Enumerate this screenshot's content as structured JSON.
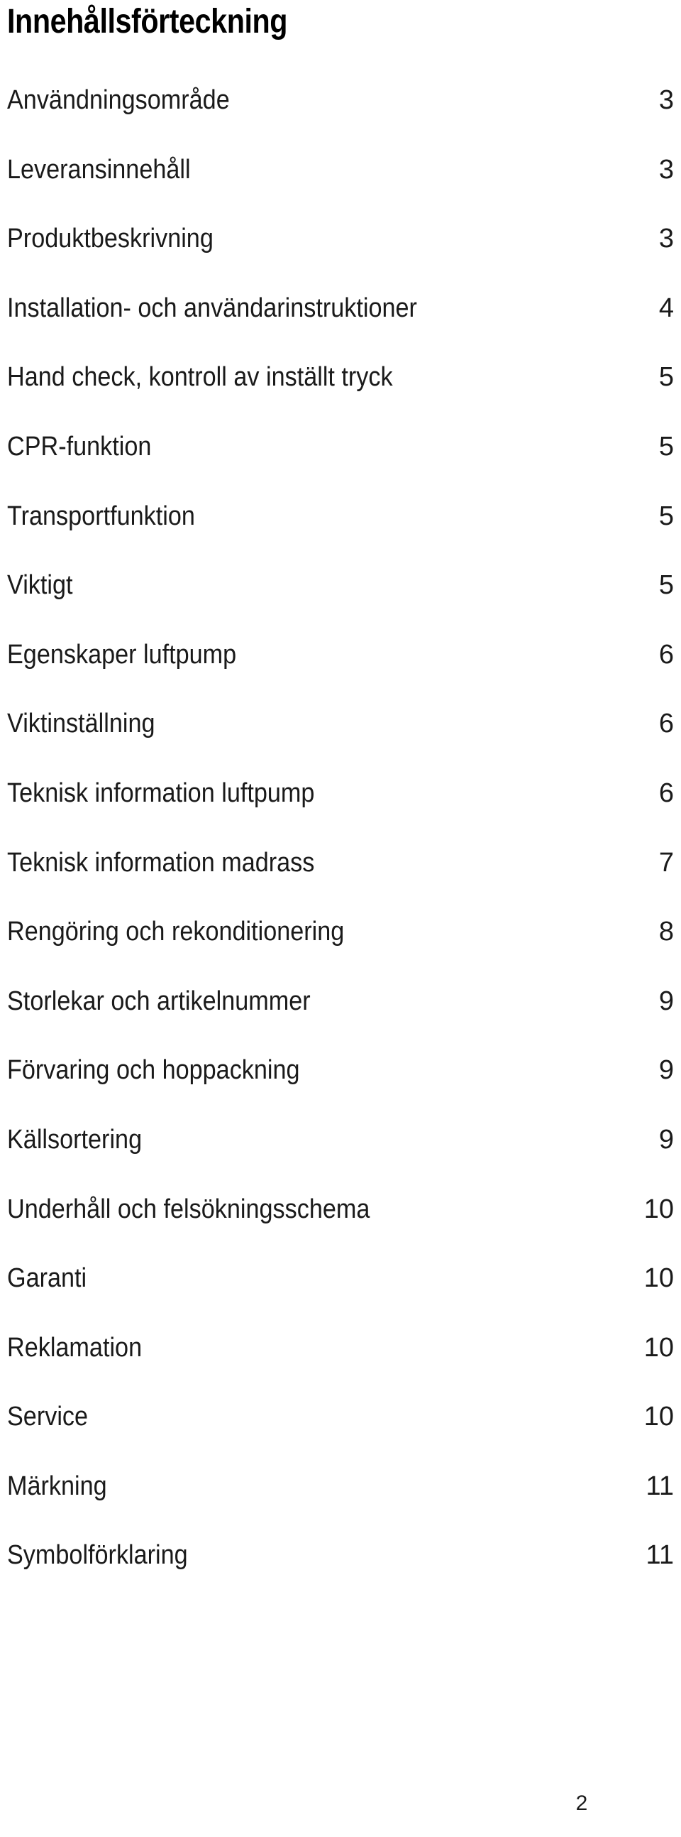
{
  "document": {
    "title": "Innehållsförteckning",
    "footer_page_number": "2"
  },
  "toc": {
    "entries": [
      {
        "label": "Användningsområde",
        "page": "3"
      },
      {
        "label": "Leveransinnehåll",
        "page": "3"
      },
      {
        "label": "Produktbeskrivning",
        "page": "3"
      },
      {
        "label": "Installation- och användarinstruktioner",
        "page": "4"
      },
      {
        "label": "Hand check, kontroll av inställt tryck",
        "page": "5"
      },
      {
        "label": "CPR-funktion",
        "page": "5"
      },
      {
        "label": "Transportfunktion",
        "page": "5"
      },
      {
        "label": "Viktigt",
        "page": "5"
      },
      {
        "label": "Egenskaper luftpump",
        "page": "6"
      },
      {
        "label": "Viktinställning",
        "page": "6"
      },
      {
        "label": "Teknisk information luftpump",
        "page": "6"
      },
      {
        "label": "Teknisk information madrass",
        "page": "7"
      },
      {
        "label": "Rengöring och rekonditionering",
        "page": "8"
      },
      {
        "label": "Storlekar och artikelnummer",
        "page": "9"
      },
      {
        "label": "Förvaring och hoppackning",
        "page": "9"
      },
      {
        "label": "Källsortering",
        "page": "9"
      },
      {
        "label": "Underhåll och felsökningsschema",
        "page": "10"
      },
      {
        "label": "Garanti",
        "page": "10"
      },
      {
        "label": "Reklamation",
        "page": "10"
      },
      {
        "label": "Service",
        "page": "10"
      },
      {
        "label": "Märkning",
        "page": "11"
      },
      {
        "label": "Symbolförklaring",
        "page": "11"
      }
    ]
  }
}
